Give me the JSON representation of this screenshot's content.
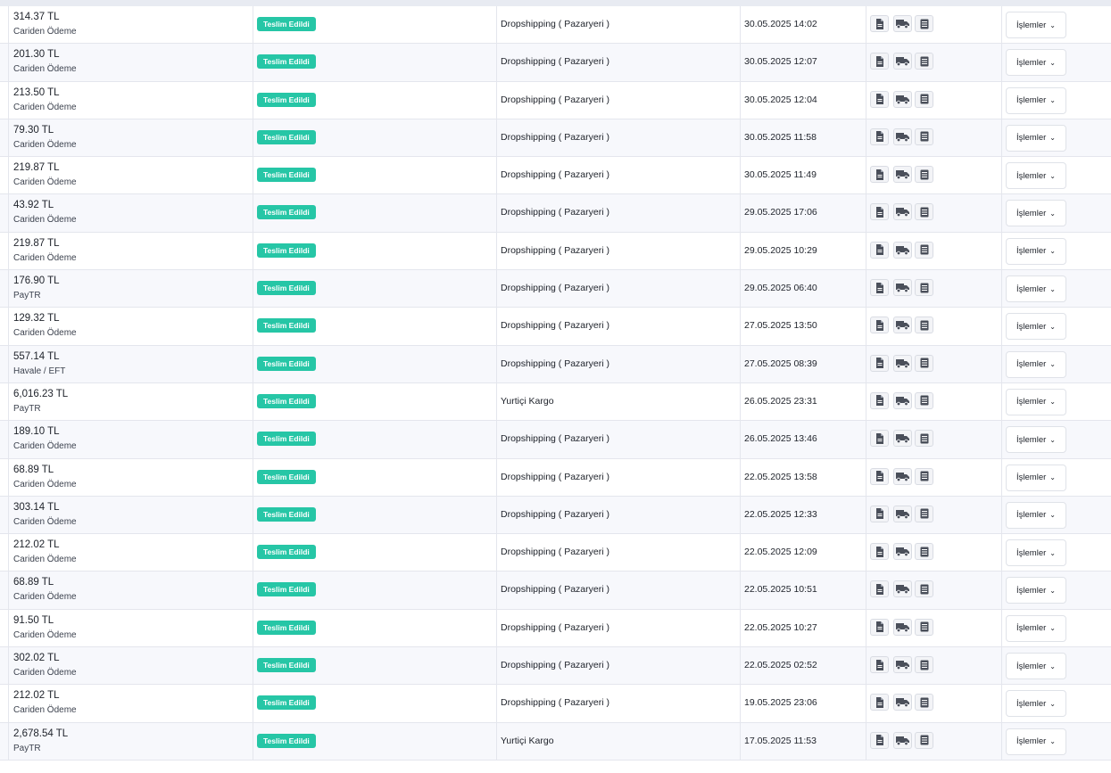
{
  "rows": [
    {
      "amount": "314.37 TL",
      "method": "Cariden Ödeme",
      "status": "Teslim Edildi",
      "cargo": "Dropshipping ( Pazaryeri )",
      "date": "30.05.2025 14:02",
      "actions": "İşlemler"
    },
    {
      "amount": "201.30 TL",
      "method": "Cariden Ödeme",
      "status": "Teslim Edildi",
      "cargo": "Dropshipping ( Pazaryeri )",
      "date": "30.05.2025 12:07",
      "actions": "İşlemler"
    },
    {
      "amount": "213.50 TL",
      "method": "Cariden Ödeme",
      "status": "Teslim Edildi",
      "cargo": "Dropshipping ( Pazaryeri )",
      "date": "30.05.2025 12:04",
      "actions": "İşlemler"
    },
    {
      "amount": "79.30 TL",
      "method": "Cariden Ödeme",
      "status": "Teslim Edildi",
      "cargo": "Dropshipping ( Pazaryeri )",
      "date": "30.05.2025 11:58",
      "actions": "İşlemler"
    },
    {
      "amount": "219.87 TL",
      "method": "Cariden Ödeme",
      "status": "Teslim Edildi",
      "cargo": "Dropshipping ( Pazaryeri )",
      "date": "30.05.2025 11:49",
      "actions": "İşlemler"
    },
    {
      "amount": "43.92 TL",
      "method": "Cariden Ödeme",
      "status": "Teslim Edildi",
      "cargo": "Dropshipping ( Pazaryeri )",
      "date": "29.05.2025 17:06",
      "actions": "İşlemler"
    },
    {
      "amount": "219.87 TL",
      "method": "Cariden Ödeme",
      "status": "Teslim Edildi",
      "cargo": "Dropshipping ( Pazaryeri )",
      "date": "29.05.2025 10:29",
      "actions": "İşlemler"
    },
    {
      "amount": "176.90 TL",
      "method": "PayTR",
      "status": "Teslim Edildi",
      "cargo": "Dropshipping ( Pazaryeri )",
      "date": "29.05.2025 06:40",
      "actions": "İşlemler"
    },
    {
      "amount": "129.32 TL",
      "method": "Cariden Ödeme",
      "status": "Teslim Edildi",
      "cargo": "Dropshipping ( Pazaryeri )",
      "date": "27.05.2025 13:50",
      "actions": "İşlemler"
    },
    {
      "amount": "557.14 TL",
      "method": "Havale / EFT",
      "status": "Teslim Edildi",
      "cargo": "Dropshipping ( Pazaryeri )",
      "date": "27.05.2025 08:39",
      "actions": "İşlemler"
    },
    {
      "amount": "6,016.23 TL",
      "method": "PayTR",
      "status": "Teslim Edildi",
      "cargo": "Yurtiçi Kargo",
      "date": "26.05.2025 23:31",
      "actions": "İşlemler"
    },
    {
      "amount": "189.10 TL",
      "method": "Cariden Ödeme",
      "status": "Teslim Edildi",
      "cargo": "Dropshipping ( Pazaryeri )",
      "date": "26.05.2025 13:46",
      "actions": "İşlemler"
    },
    {
      "amount": "68.89 TL",
      "method": "Cariden Ödeme",
      "status": "Teslim Edildi",
      "cargo": "Dropshipping ( Pazaryeri )",
      "date": "22.05.2025 13:58",
      "actions": "İşlemler"
    },
    {
      "amount": "303.14 TL",
      "method": "Cariden Ödeme",
      "status": "Teslim Edildi",
      "cargo": "Dropshipping ( Pazaryeri )",
      "date": "22.05.2025 12:33",
      "actions": "İşlemler"
    },
    {
      "amount": "212.02 TL",
      "method": "Cariden Ödeme",
      "status": "Teslim Edildi",
      "cargo": "Dropshipping ( Pazaryeri )",
      "date": "22.05.2025 12:09",
      "actions": "İşlemler"
    },
    {
      "amount": "68.89 TL",
      "method": "Cariden Ödeme",
      "status": "Teslim Edildi",
      "cargo": "Dropshipping ( Pazaryeri )",
      "date": "22.05.2025 10:51",
      "actions": "İşlemler"
    },
    {
      "amount": "91.50 TL",
      "method": "Cariden Ödeme",
      "status": "Teslim Edildi",
      "cargo": "Dropshipping ( Pazaryeri )",
      "date": "22.05.2025 10:27",
      "actions": "İşlemler"
    },
    {
      "amount": "302.02 TL",
      "method": "Cariden Ödeme",
      "status": "Teslim Edildi",
      "cargo": "Dropshipping ( Pazaryeri )",
      "date": "22.05.2025 02:52",
      "actions": "İşlemler"
    },
    {
      "amount": "212.02 TL",
      "method": "Cariden Ödeme",
      "status": "Teslim Edildi",
      "cargo": "Dropshipping ( Pazaryeri )",
      "date": "19.05.2025 23:06",
      "actions": "İşlemler"
    },
    {
      "amount": "2,678.54 TL",
      "method": "PayTR",
      "status": "Teslim Edildi",
      "cargo": "Yurtiçi Kargo",
      "date": "17.05.2025 11:53",
      "actions": "İşlemler"
    }
  ],
  "icons": [
    "document-icon",
    "truck-icon",
    "list-icon"
  ],
  "colors": {
    "status_badge": "#26c6a6",
    "row_alt": "#f7f8fc",
    "border": "#e4e6ed"
  }
}
